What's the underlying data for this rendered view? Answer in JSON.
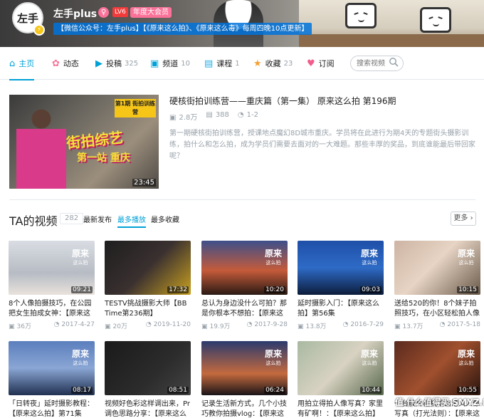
{
  "header": {
    "avatar_text": "左手",
    "username": "左手plus",
    "gender": "♀",
    "level": "LV6",
    "vip": "年度大会员",
    "sign": "【微信公众号：左手plus】【《原来这么拍》、《原来这么毒》每周四晚10点更新】"
  },
  "nav": {
    "items": [
      {
        "label": "主页",
        "count": "",
        "icon": "home-icon",
        "active": true
      },
      {
        "label": "动态",
        "count": "",
        "icon": "activity-icon"
      },
      {
        "label": "投稿",
        "count": "325",
        "icon": "upload-icon"
      },
      {
        "label": "频道",
        "count": "10",
        "icon": "channel-icon"
      },
      {
        "label": "课程",
        "count": "1",
        "icon": "course-icon"
      },
      {
        "label": "收藏",
        "count": "23",
        "icon": "star-icon"
      },
      {
        "label": "订阅",
        "count": "",
        "icon": "heart-icon"
      }
    ],
    "search_placeholder": "搜索视频"
  },
  "featured": {
    "title": "硬核街拍训练营——重庆篇（第一集） 原来这么拍 第196期",
    "plays": "2.8万",
    "danmaku": "388",
    "parts": "1-2",
    "desc": "第一期硬核街拍训练营，授课地点魔幻8D城市重庆。学员将在此进行为期4天的专题街头摄影训练，拍什么和怎么拍，成为学员们需要去面对的一大难题。那些丰厚的奖品，到底谁能最后带回家呢？",
    "duration": "23:45",
    "thumb_tag": "第1期 街拍训练营",
    "thumb_big": "街拍综艺",
    "thumb_sub": "第一站 重庆"
  },
  "videos_section": {
    "title": "TA的视频",
    "count": "282",
    "sorts": [
      "最新发布",
      "最多播放",
      "最多收藏"
    ],
    "active_sort": 1,
    "more": "更多 ›"
  },
  "videos": [
    {
      "title": "8个人像拍摄技巧，在公园把女生拍成女神：【原来这么",
      "plays": "36万",
      "date": "2017-4-27",
      "duration": "09:21",
      "bg": "linear-gradient(180deg,#d9dde3 0%,#b7bcc4 60%,#e8e2dc 100%)"
    },
    {
      "title": "TESTV挑战摄影大师【BB Time第236期】",
      "plays": "20万",
      "date": "2019-11-20",
      "duration": "17:32",
      "bg": "linear-gradient(135deg,#1e1e1e 0%,#3a3030 50%,#c8a020 100%)"
    },
    {
      "title": "总认为身边没什么可拍？那是你根本不想拍：【原来这么",
      "plays": "19.9万",
      "date": "2017-9-28",
      "duration": "10:20",
      "bg": "linear-gradient(180deg,#3d4f8a 0%,#c55b3a 55%,#2a1a14 100%)"
    },
    {
      "title": "延时摄影入门：【原来这么拍】第56集",
      "plays": "13.8万",
      "date": "2016-7-29",
      "duration": "09:03",
      "bg": "linear-gradient(180deg,#1f4fa8 0%,#2e6bc6 50%,#0c1c3a 100%)"
    },
    {
      "title": "送给520的你！8个妹子拍照技巧，在小区轻松拍人像大",
      "plays": "13.7万",
      "date": "2017-5-18",
      "duration": "10:15",
      "bg": "linear-gradient(135deg,#cdb4a4 0%,#e7d4c4 45%,#6a5a4a 100%)"
    },
    {
      "title": "「日转夜」延时摄影教程：【原来这么拍】第71集",
      "plays": "",
      "date": "",
      "duration": "08:17",
      "bg": "linear-gradient(180deg,#5b7ebd 0%,#8aa6d4 50%,#203050 100%)"
    },
    {
      "title": "视频好色彩这样调出来，Pr调色思路分享：【原来这么拍",
      "plays": "",
      "date": "",
      "duration": "08:51",
      "bg": "linear-gradient(135deg,#1a1a1a 0%,#2c2c2c 60%,#444 100%)"
    },
    {
      "title": "记录生活新方式，几个小技巧教你拍摄vlog：【原来这么",
      "plays": "",
      "date": "",
      "duration": "06:24",
      "bg": "linear-gradient(180deg,#2b3a6e 0%,#c46a3e 60%,#1a1418 100%)"
    },
    {
      "title": "用拍立得拍人像写真？家里有矿啊！：【原来这么拍】144",
      "plays": "",
      "date": "",
      "duration": "10:44",
      "bg": "linear-gradient(135deg,#a9b9a2 0%,#d8d2c2 50%,#55664a 100%)"
    },
    {
      "title": "一台胶片相机拍出港风人像写真（打光法则）：【原来这么拍",
      "plays": "",
      "date": "",
      "duration": "10:55",
      "bg": "linear-gradient(135deg,#5a2a1e 0%,#a0502e 50%,#2a140e 100%)"
    }
  ],
  "watermark": "值 什么值得买 SMYZ.NET",
  "colors": {
    "accent": "#00a1d6",
    "pink": "#fb7299",
    "gray": "#99a2aa"
  }
}
